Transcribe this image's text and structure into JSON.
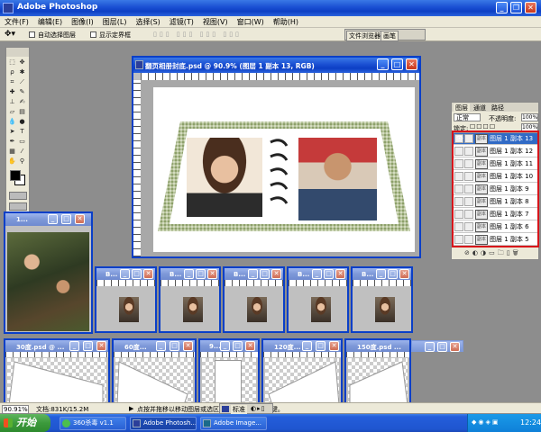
{
  "app": {
    "title": "Adobe Photoshop",
    "menu": [
      "文件(F)",
      "编辑(E)",
      "图像(I)",
      "图层(L)",
      "选择(S)",
      "滤镜(T)",
      "视图(V)",
      "窗口(W)",
      "帮助(H)"
    ],
    "options": {
      "auto_select": "自动选择图层",
      "show_bounds": "显示定界框"
    },
    "palette_tabs": [
      "文件浏览器",
      "画笔"
    ]
  },
  "main_doc": {
    "title": "翻页相册封底.psd @ 90.9% (图层 1 副本 13, RGB)"
  },
  "small_doc": {
    "title": "1..."
  },
  "thumb_docs": [
    "B...",
    "B...",
    "B...",
    "B...",
    "B..."
  ],
  "bottom_docs": [
    "30度.psd @ ...",
    "60度...",
    "9...",
    "120度...",
    "150度.psd ..."
  ],
  "layers": {
    "tabs": [
      "图层",
      "通道",
      "路径"
    ],
    "blend_mode": "正常",
    "opacity_label": "不透明度:",
    "opacity_value": "100%",
    "lock_label": "锁定:",
    "fill_value": "100%",
    "thumb_label": "副本",
    "items": [
      "图层 1 副本 13",
      "图层 1 副本 12",
      "图层 1 副本 11",
      "图层 1 副本 10",
      "图层 1 副本 9",
      "图层 1 副本 8",
      "图层 1 副本 7",
      "图层 1 副本 6",
      "图层 1 副本 5"
    ]
  },
  "status": {
    "zoom": "90.91%",
    "doc_size": "文档:831K/15.2M",
    "hint": "点按并拖移以移动图层或选区。要用 Shift、Alt 键。",
    "mini_tab": "标准"
  },
  "taskbar": {
    "start": "开始",
    "items": [
      "360杀毒 v1.1",
      "Adobe Photosh...",
      "Adobe Image..."
    ],
    "clock": "12:24"
  },
  "colors": {
    "xp_blue": "#0c3fc4",
    "highlight": "#d7141a",
    "taskbar": "#245edb",
    "start": "#3c9a3c"
  }
}
